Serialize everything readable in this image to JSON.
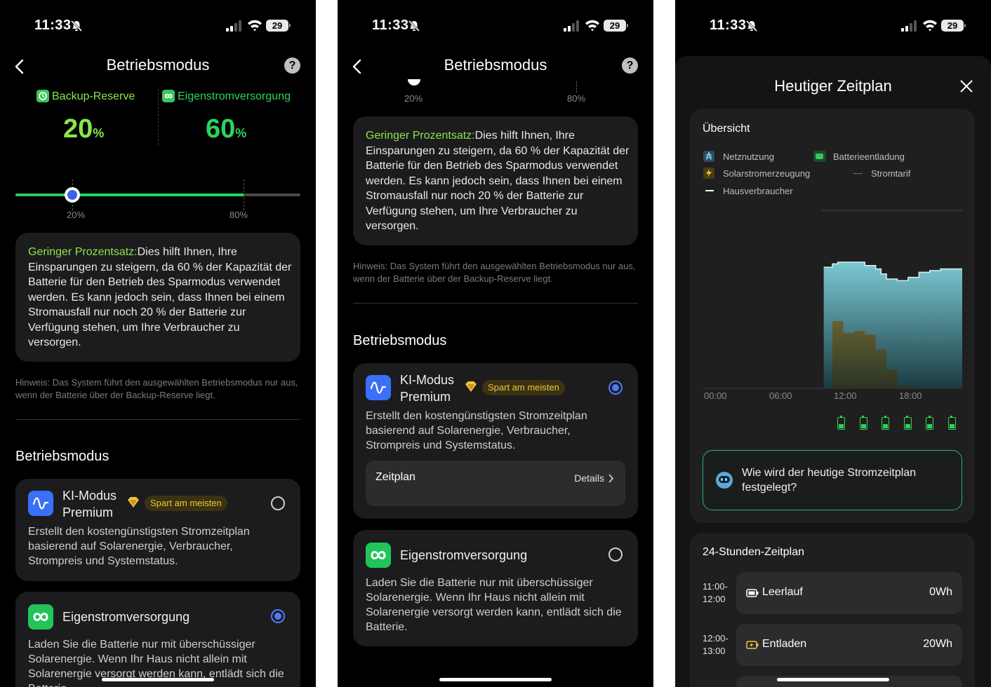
{
  "status": {
    "time": "11:33",
    "battery": "29"
  },
  "screen1": {
    "title": "Betriebsmodus",
    "help": "?",
    "backup_label": "Backup-Reserve",
    "backup_value": "20",
    "self_label": "Eigenstromversorgung",
    "self_value": "60",
    "pct_unit": "%",
    "slider": {
      "value_fraction": 0.2,
      "marker2_fraction": 0.8,
      "label_low": "20%",
      "label_high": "80%"
    },
    "info_highlight": "Geringer Prozentsatz:",
    "info_text": "Dies hilft Ihnen, Ihre Einsparungen zu steigern, da 60 % der Kapazität der Batterie für den Betrieb des Sparmodus verwendet werden. Es kann jedoch sein, dass Ihnen bei einem Stromausfall nur noch 20 % der Batterie zur Verfügung stehen, um Ihre Verbraucher zu versorgen.",
    "hint": "Hinweis: Das System führt den ausgewählten Betriebsmodus nur aus, wenn der Batterie über der Backup-Reserve liegt.",
    "section": "Betriebsmodus",
    "ki_name_1": "KI-Modus",
    "ki_name_2": "Premium",
    "ki_badge": "Spart am meisten",
    "ki_desc": "Erstellt den kostengünstigsten Stromzeitplan basierend auf Solarenergie, Verbraucher, Strompreis und Systemstatus.",
    "eigen_name": "Eigenstromversorgung",
    "eigen_desc": "Laden Sie die Batterie nur mit überschüssiger Solarenergie. Wenn Ihr Haus nicht allein mit Solarenergie versorgt werden kann, entlädt sich die Batterie."
  },
  "screen2": {
    "title": "Betriebsmodus",
    "help": "?",
    "label_low": "20%",
    "label_high": "80%",
    "info_highlight": "Geringer Prozentsatz:",
    "info_text": "Dies hilft Ihnen, Ihre Einsparungen zu steigern, da 60 % der Kapazität der Batterie für den Betrieb des Sparmodus verwendet werden. Es kann jedoch sein, dass Ihnen bei einem Stromausfall nur noch 20 % der Batterie zur Verfügung stehen, um Ihre Verbraucher zu versorgen.",
    "hint": "Hinweis: Das System führt den ausgewählten Betriebsmodus nur aus, wenn der Batterie über der Backup-Reserve liegt.",
    "section": "Betriebsmodus",
    "ki_name_1": "KI-Modus",
    "ki_name_2": "Premium",
    "ki_badge": "Spart am meisten",
    "ki_desc": "Erstellt den kostengünstigsten Stromzeitplan basierend auf Solarenergie, Verbraucher, Strompreis und Systemstatus.",
    "zeitplan": "Zeitplan",
    "details": "Details",
    "eigen_name": "Eigenstromversorgung",
    "eigen_desc": "Laden Sie die Batterie nur mit überschüssiger Solarenergie. Wenn Ihr Haus nicht allein mit Solarenergie versorgt werden kann, entlädt sich die Batterie."
  },
  "screen3": {
    "title": "Heutiger Zeitplan",
    "overview": "Übersicht",
    "legend": {
      "grid": "Netznutzung",
      "discharge": "Batterieentladung",
      "solar": "Solarstromerzeugung",
      "tariff": "Stromtarif",
      "house": "Hausverbraucher"
    },
    "ticks": [
      "00:00",
      "06:00",
      "12:00",
      "18:00"
    ],
    "question": "Wie wird der heutige Stromzeitplan festgelegt?",
    "schedule_title": "24-Stunden-Zeitplan",
    "rows": [
      {
        "from": "11:00-",
        "to": "12:00",
        "mode": "Leerlauf",
        "energy": "0Wh"
      },
      {
        "from": "12:00-",
        "to": "13:00",
        "mode": "Entladen",
        "energy": "20Wh"
      }
    ]
  },
  "chart_data": {
    "type": "area",
    "x_range_hours": [
      0,
      24
    ],
    "series": [
      {
        "name": "Netznutzung",
        "x": [
          11.2,
          12,
          12.5,
          13,
          14,
          15,
          16,
          16.5,
          17,
          18,
          19,
          20,
          21,
          22,
          23,
          24
        ],
        "values": [
          0.72,
          0.74,
          0.75,
          0.75,
          0.75,
          0.73,
          0.71,
          0.68,
          0.65,
          0.64,
          0.66,
          0.69,
          0.7,
          0.71,
          0.71,
          0.71
        ]
      },
      {
        "name": "Solarstromerzeugung",
        "x": [
          11.2,
          12,
          13,
          14,
          15,
          16,
          17,
          18,
          19
        ],
        "values": [
          0,
          0.4,
          0.33,
          0.34,
          0.32,
          0.23,
          0.11,
          0.02,
          0
        ]
      }
    ],
    "battery_slots": 6
  }
}
